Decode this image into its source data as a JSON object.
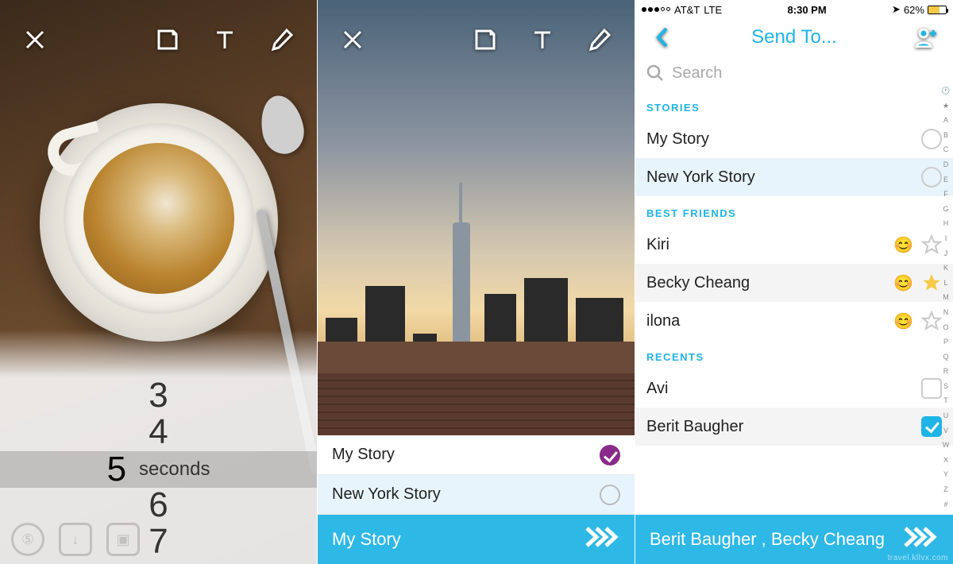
{
  "panel1": {
    "timer": {
      "values": [
        "3",
        "4",
        "5",
        "6",
        "7"
      ],
      "selected_index": 2,
      "unit": "seconds"
    }
  },
  "panel2": {
    "stories": [
      {
        "label": "My Story",
        "checked": true
      },
      {
        "label": "New York Story",
        "checked": false
      }
    ],
    "send_bar_label": "My Story"
  },
  "panel3": {
    "status": {
      "carrier": "AT&T",
      "network": "LTE",
      "time": "8:30 PM",
      "battery_pct": "62%"
    },
    "nav_title": "Send To...",
    "search_placeholder": "Search",
    "sections": {
      "stories_header": "STORIES",
      "stories": [
        {
          "label": "My Story",
          "highlight": false
        },
        {
          "label": "New York Story",
          "highlight": true
        }
      ],
      "best_friends_header": "BEST FRIENDS",
      "best_friends": [
        {
          "label": "Kiri",
          "emoji": "😊",
          "starred": false,
          "alt": false
        },
        {
          "label": "Becky Cheang",
          "emoji": "😊",
          "starred": true,
          "alt": true
        },
        {
          "label": "ilona",
          "emoji": "😊",
          "starred": false,
          "alt": false
        }
      ],
      "recents_header": "RECENTS",
      "recents": [
        {
          "label": "Avi",
          "checked": false,
          "alt": false
        },
        {
          "label": "Berit Baugher",
          "checked": true,
          "alt": true
        }
      ]
    },
    "index_rail": [
      "🕐",
      "★",
      "A",
      "B",
      "C",
      "D",
      "E",
      "F",
      "G",
      "H",
      "I",
      "J",
      "K",
      "L",
      "M",
      "N",
      "O",
      "P",
      "Q",
      "R",
      "S",
      "T",
      "U",
      "V",
      "W",
      "X",
      "Y",
      "Z",
      "#"
    ],
    "send_bar_label": "Berit Baugher , Becky Cheang"
  },
  "watermark": "travel.kllvx.com"
}
